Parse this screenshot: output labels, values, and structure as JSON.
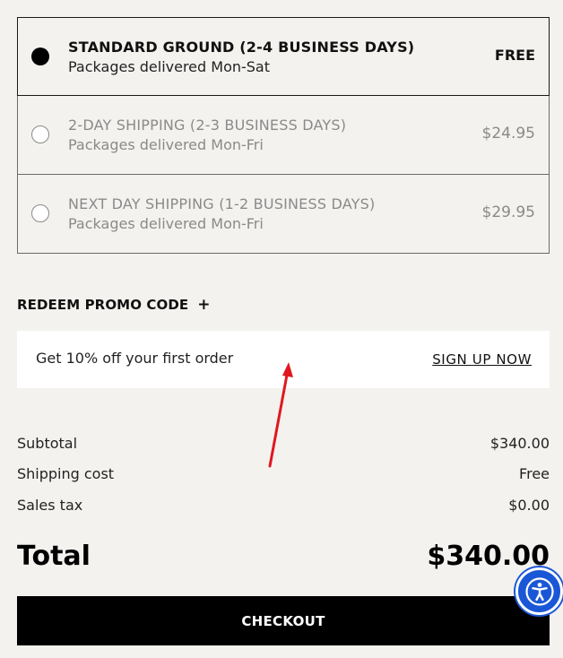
{
  "shipping": {
    "options": [
      {
        "title": "STANDARD GROUND (2-4 BUSINESS DAYS)",
        "subtitle": "Packages delivered Mon-Sat",
        "price": "FREE",
        "selected": true
      },
      {
        "title": "2-DAY SHIPPING (2-3 BUSINESS DAYS)",
        "subtitle": "Packages delivered Mon-Fri",
        "price": "$24.95",
        "selected": false
      },
      {
        "title": "NEXT DAY SHIPPING (1-2 BUSINESS DAYS)",
        "subtitle": "Packages delivered Mon-Fri",
        "price": "$29.95",
        "selected": false
      }
    ]
  },
  "promo": {
    "label": "REDEEM PROMO CODE",
    "icon": "plus-icon"
  },
  "signup": {
    "text": "Get 10% off your first order",
    "link": "SIGN UP NOW"
  },
  "summary": {
    "subtotal_label": "Subtotal",
    "subtotal_value": "$340.00",
    "shipping_label": "Shipping cost",
    "shipping_value": "Free",
    "tax_label": "Sales tax",
    "tax_value": "$0.00",
    "total_label": "Total",
    "total_value": "$340.00"
  },
  "checkout": {
    "label": "CHECKOUT"
  },
  "accessibility": {
    "icon": "accessibility-icon",
    "color": "#1a57d6"
  },
  "annotation": {
    "icon": "red-arrow-icon",
    "color": "#e0171f"
  }
}
